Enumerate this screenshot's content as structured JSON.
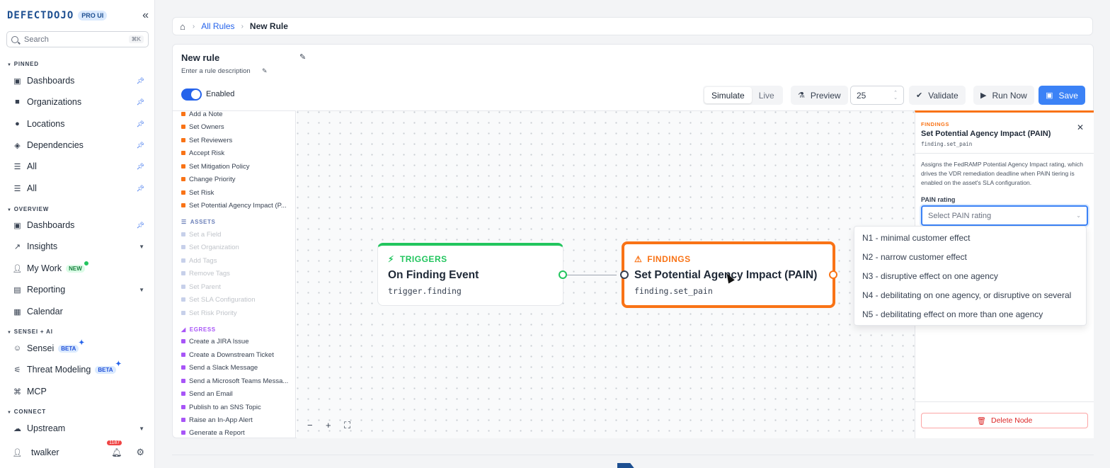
{
  "app": {
    "logo": "DEFECTDOJO",
    "edition_badge": "PRO UI",
    "collapse_icon": "double-chevron-left-icon"
  },
  "sidebar": {
    "search": {
      "placeholder": "Search",
      "shortcut": "⌘K"
    },
    "sections": {
      "pinned": "PINNED",
      "overview": "OVERVIEW",
      "sensei": "SENSEI + AI",
      "connect": "CONNECT"
    },
    "pinned_items": [
      {
        "label": "Dashboards",
        "icon": "dashboard-icon"
      },
      {
        "label": "Organizations",
        "icon": "briefcase-icon"
      },
      {
        "label": "Locations",
        "icon": "map-pin-icon"
      },
      {
        "label": "Dependencies",
        "icon": "cubes-icon"
      },
      {
        "label": "All",
        "icon": "list-icon"
      },
      {
        "label": "All",
        "icon": "list-icon"
      }
    ],
    "overview_items": [
      {
        "label": "Dashboards",
        "icon": "dashboard-icon"
      },
      {
        "label": "Insights",
        "icon": "chart-line-icon"
      },
      {
        "label": "My Work",
        "icon": "user-icon",
        "badge": "NEW"
      },
      {
        "label": "Reporting",
        "icon": "document-icon"
      },
      {
        "label": "Calendar",
        "icon": "calendar-icon"
      }
    ],
    "sensei_items": [
      {
        "label": "Sensei",
        "icon": "robot-icon",
        "badge": "BETA"
      },
      {
        "label": "Threat Modeling",
        "icon": "diagram-icon",
        "badge": "BETA"
      },
      {
        "label": "MCP",
        "icon": "mcp-icon"
      }
    ],
    "connect_items": [
      {
        "label": "Upstream",
        "icon": "cloud-icon"
      }
    ],
    "user": {
      "name": "twalker",
      "notifications": "1187"
    }
  },
  "breadcrumb": {
    "home_icon": "home-icon",
    "parent": "All Rules",
    "current": "New Rule"
  },
  "rule": {
    "name": "New rule",
    "description_placeholder": "Enter a rule description",
    "enabled": true,
    "enabled_label": "Enabled"
  },
  "toolbar": {
    "modes": [
      "Simulate",
      "Live"
    ],
    "active_mode": "Simulate",
    "preview_label": "Preview",
    "count": "25",
    "validate_label": "Validate",
    "run_now_label": "Run Now",
    "save_label": "Save"
  },
  "palette": {
    "findings_items": [
      "Add a Note",
      "Set Owners",
      "Set Reviewers",
      "Accept Risk",
      "Set Mitigation Policy",
      "Change Priority",
      "Set Risk",
      "Set Potential Agency Impact (P..."
    ],
    "assets_header": "ASSETS",
    "assets_items": [
      "Set a Field",
      "Set Organization",
      "Add Tags",
      "Remove Tags",
      "Set Parent",
      "Set SLA Configuration",
      "Set Risk Priority"
    ],
    "egress_header": "EGRESS",
    "egress_items": [
      "Create a JIRA Issue",
      "Create a Downstream Ticket",
      "Send a Slack Message",
      "Send a Microsoft Teams Messa...",
      "Send an Email",
      "Publish to an SNS Topic",
      "Raise an In-App Alert",
      "Generate a Report"
    ],
    "colors": {
      "findings": "#f97316",
      "assets": "#6b7fb8",
      "egress": "#a855f7"
    }
  },
  "canvas": {
    "trigger_node": {
      "category": "TRIGGERS",
      "title": "On Finding Event",
      "code": "trigger.finding"
    },
    "findings_node": {
      "category": "FINDINGS",
      "title": "Set Potential Agency Impact (PAIN)",
      "code": "finding.set_pain"
    },
    "controls": {
      "zoom_out": "−",
      "zoom_in": "+",
      "fit": "⛶"
    }
  },
  "panel": {
    "category": "FINDINGS",
    "title": "Set Potential Agency Impact (PAIN)",
    "code": "finding.set_pain",
    "description": "Assigns the FedRAMP Potential Agency Impact rating, which drives the VDR remediation deadline when PAIN tiering is enabled on the asset's SLA configuration.",
    "field_label": "PAIN rating",
    "select_placeholder": "Select PAIN rating",
    "delete_label": "Delete Node"
  },
  "pain_options": [
    "N1 - minimal customer effect",
    "N2 - narrow customer effect",
    "N3 - disruptive effect on one agency",
    "N4 - debilitating on one agency, or disruptive on several",
    "N5 - debilitating effect on more than one agency"
  ]
}
